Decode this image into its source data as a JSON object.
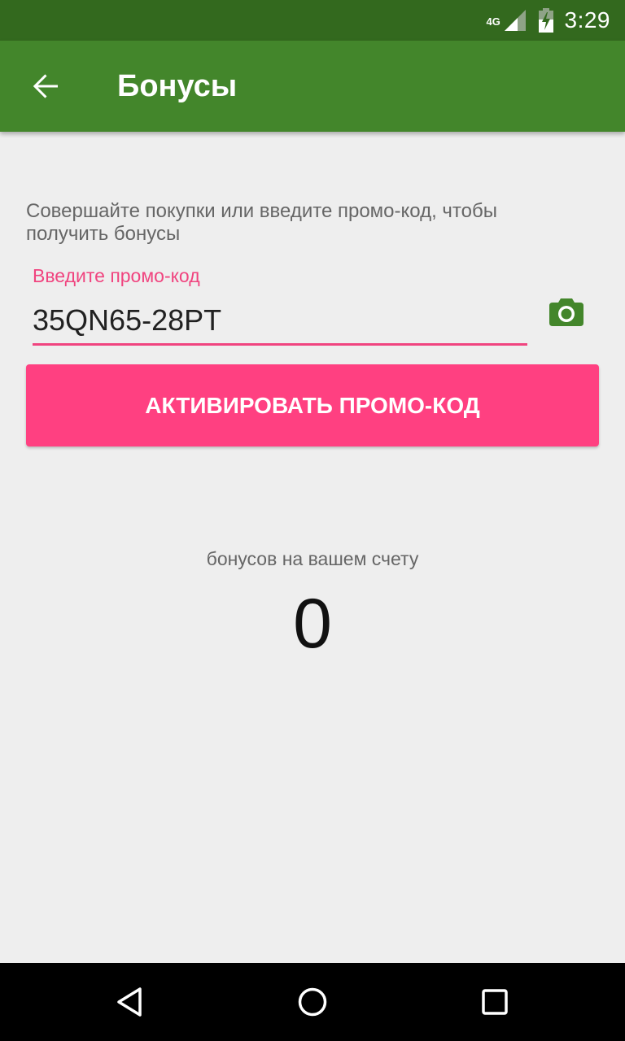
{
  "status_bar": {
    "network": "4G",
    "time": "3:29",
    "icons": [
      "signal-icon",
      "battery-charging-icon"
    ]
  },
  "toolbar": {
    "title": "Бонусы",
    "back_icon": "arrow-back-icon"
  },
  "promo": {
    "hint": "Совершайте покупки или введите промо-код, чтобы получить бонусы",
    "label": "Введите промо-код",
    "value": "35QN65-28PT",
    "camera_icon": "camera-icon",
    "activate_label": "АКТИВИРОВАТЬ ПРОМО-КОД"
  },
  "bonuses": {
    "caption": "бонусов на вашем счету",
    "value": "0"
  },
  "nav_bar": {
    "buttons": [
      "back-triangle-icon",
      "home-circle-icon",
      "recents-square-icon"
    ]
  },
  "colors": {
    "status_bar": "#33691e",
    "toolbar": "#43862b",
    "accent": "#ff4081",
    "accent_text": "#f0447f",
    "camera": "#43862b",
    "background": "#eeeeee"
  }
}
